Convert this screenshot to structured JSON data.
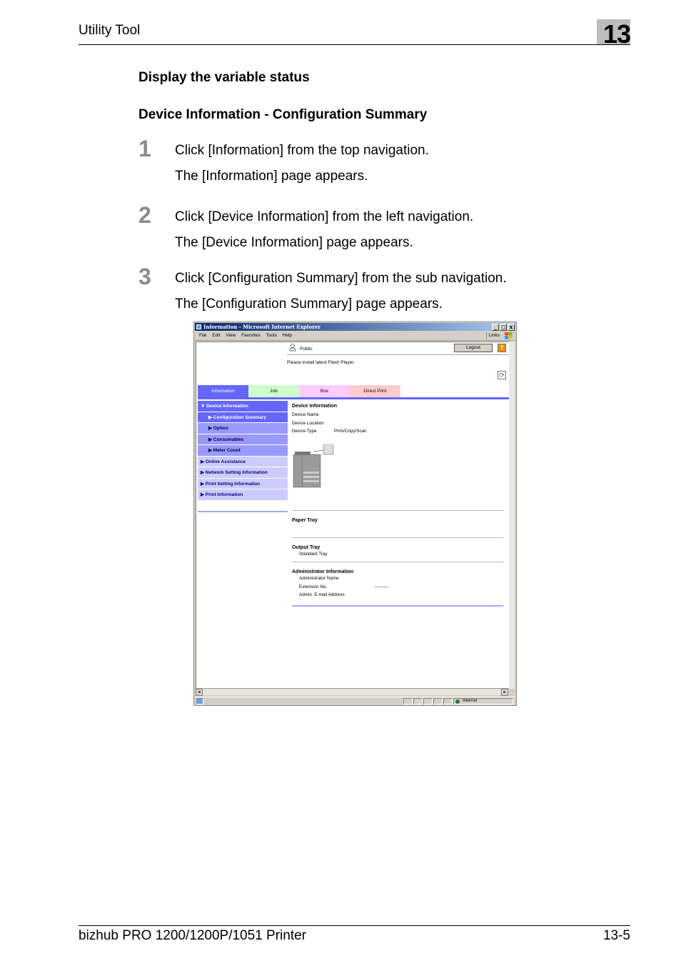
{
  "doc_header": {
    "title": "Utility Tool",
    "chapter": "13"
  },
  "section_title": "Display the variable status",
  "subsection_title": "Device Information - Configuration Summary",
  "steps": [
    {
      "number": "1",
      "instruction": "Click [Information] from the top navigation.",
      "result": "The [Information] page appears."
    },
    {
      "number": "2",
      "instruction": "Click [Device Information] from the left navigation.",
      "result": "The [Device Information] page appears."
    },
    {
      "number": "3",
      "instruction": "Click [Configuration Summary] from the sub navigation.",
      "result": "The [Configuration Summary] page appears."
    }
  ],
  "browser": {
    "window_title": "Information - Microsoft Internet Explorer",
    "window_buttons": [
      "_",
      "□",
      "x"
    ],
    "menu": [
      "File",
      "Edit",
      "View",
      "Favorites",
      "Tools",
      "Help"
    ],
    "links_label": "Links",
    "status_zone": "Internet",
    "scroll_left": "◂",
    "scroll_right": "▸"
  },
  "webpage": {
    "user_mode": "Public",
    "logout_label": "Logout",
    "help_label": "?",
    "refresh_label": "⟳",
    "flash_message": "Please install latest Flash Player.",
    "tabs": [
      {
        "label": "Information",
        "color": "#6666ff",
        "text_color": "#ffffff",
        "active": true
      },
      {
        "label": "Job",
        "color": "#ccffcc",
        "text_color": "#000000",
        "active": false
      },
      {
        "label": "Box",
        "color": "#ffccff",
        "text_color": "#000000",
        "active": false
      },
      {
        "label": "Direct Print",
        "color": "#ffcccc",
        "text_color": "#000000",
        "active": false
      }
    ],
    "left_nav": [
      {
        "label": "▼ Device Information",
        "level": 0,
        "state": "expanded"
      },
      {
        "label": "▶ Configuration Summary",
        "level": 1,
        "state": "selected"
      },
      {
        "label": "▶ Option",
        "level": 1,
        "state": "normal"
      },
      {
        "label": "▶ Consumables",
        "level": 1,
        "state": "normal"
      },
      {
        "label": "▶ Meter Count",
        "level": 1,
        "state": "normal"
      },
      {
        "label": "▶ Online Assistance",
        "level": 0,
        "state": "collapsed"
      },
      {
        "label": "▶ Network Setting Information",
        "level": 0,
        "state": "collapsed"
      },
      {
        "label": "▶ Print Setting Information",
        "level": 0,
        "state": "collapsed"
      },
      {
        "label": "▶ Print Information",
        "level": 0,
        "state": "collapsed"
      }
    ],
    "nav_colors": {
      "expanded": "#6666ff",
      "selected": "#6666ff",
      "sub": "#9999ff",
      "collapsed": "#ccccff"
    },
    "device_info": {
      "heading": "Device Information",
      "rows": [
        {
          "label": "Device Name",
          "value": ""
        },
        {
          "label": "Device Location",
          "value": ""
        },
        {
          "label": "Device Type",
          "value": "Print/Copy/Scan"
        }
      ]
    },
    "paper_tray": {
      "heading": "Paper Tray"
    },
    "output_tray": {
      "heading": "Output Tray",
      "rows": [
        {
          "label": "Standard Tray",
          "value": ""
        }
      ]
    },
    "admin_info": {
      "heading": "Administrator Information",
      "rows": [
        {
          "label": "Administrator Name",
          "value": ""
        },
        {
          "label": "Extension No.",
          "value": "---------"
        },
        {
          "label": "Admin. E-mail Address",
          "value": ""
        }
      ]
    }
  },
  "doc_footer": {
    "product": "bizhub PRO 1200/1200P/1051 Printer",
    "page": "13-5"
  }
}
